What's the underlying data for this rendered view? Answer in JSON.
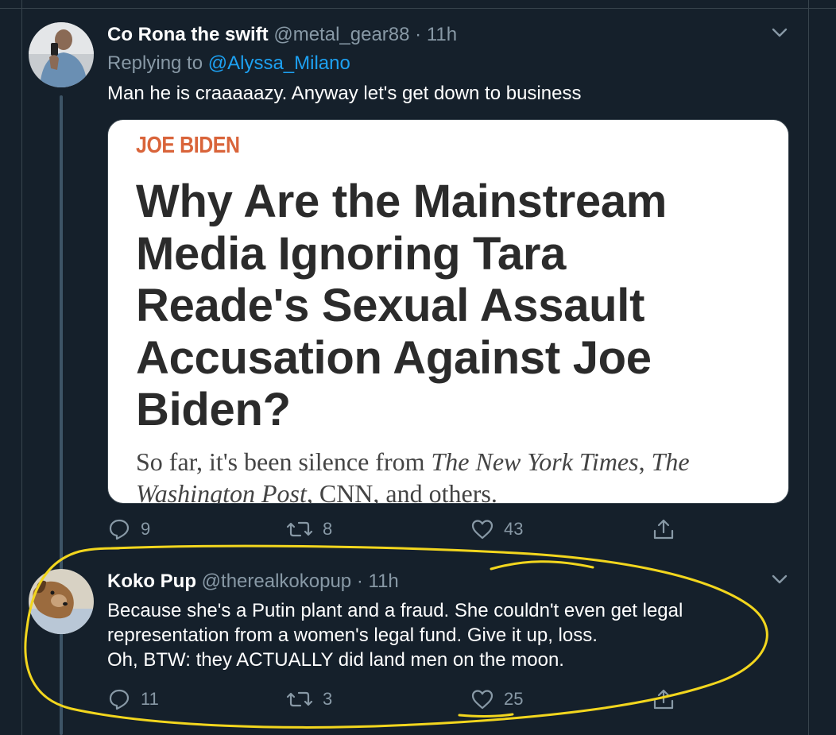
{
  "tweets": [
    {
      "display_name": "Co Rona the swift",
      "handle": "@metal_gear88",
      "separator": "·",
      "time": "11h",
      "replying_prefix": "Replying to",
      "replying_mention": "@Alyssa_Milano",
      "text": "Man he is craaaaazy. Anyway let's get down to business",
      "card": {
        "kicker": "JOE BIDEN",
        "title": "Why Are the Mainstream Media Ignoring Tara Reade's Sexual Assault Accusation Against Joe Biden?",
        "sub_part1": "So far, it's been silence from ",
        "sub_italic1": "The New York Times",
        "sub_part2": ", ",
        "sub_italic2": "The Washington Post",
        "sub_part3": ", CNN, and others."
      },
      "actions": {
        "replies": "9",
        "retweets": "8",
        "likes": "43"
      }
    },
    {
      "display_name": "Koko Pup",
      "handle": "@therealkokopup",
      "separator": "·",
      "time": "11h",
      "text_line1": "Because she's a Putin plant and a fraud. She couldn't even get legal",
      "text_line2": "representation from a women's legal fund. Give it up, loss.",
      "text_line3": "Oh, BTW: they ACTUALLY did land men on the moon.",
      "actions": {
        "replies": "11",
        "retweets": "3",
        "likes": "25"
      }
    }
  ],
  "icons": {
    "reply": "reply-icon",
    "retweet": "retweet-icon",
    "like": "heart-icon",
    "share": "share-icon",
    "more": "chevron-down-icon"
  },
  "colors": {
    "background": "#15202b",
    "secondary_text": "#8899a6",
    "link": "#1da1f2",
    "annotation": "#f2d61e",
    "kicker": "#d9643a"
  }
}
